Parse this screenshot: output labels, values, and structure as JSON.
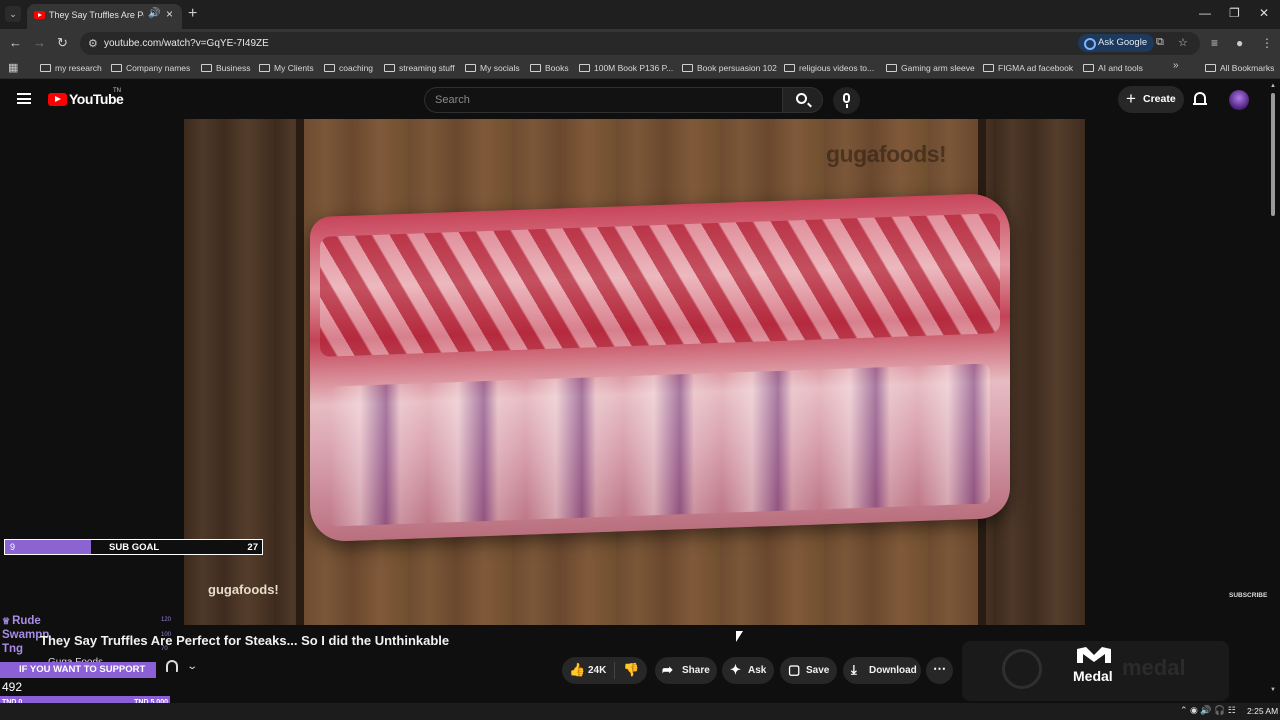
{
  "browser": {
    "tab_title": "They Say Truffles Are Perfect",
    "url": "youtube.com/watch?v=GqYE-7I49ZE",
    "ask_google": "Ask Google",
    "bookmarks": [
      "my research",
      "Company names",
      "Business",
      "My Clients",
      "coaching",
      "streaming stuff",
      "My socials",
      "Books",
      "100M Book P136 P...",
      "Book persuasion 102",
      "religious videos to...",
      "Gaming arm sleeve",
      "FIGMA ad facebook",
      "AI and tools"
    ],
    "all_bookmarks": "All Bookmarks"
  },
  "youtube": {
    "logo_text": "YouTube",
    "logo_sup": "TN",
    "search_placeholder": "Search",
    "create_label": "Create"
  },
  "video": {
    "watermark_top": "gugafoods!",
    "watermark_bottom": "gugafoods!",
    "subscribe_label": "SUBSCRIBE",
    "title": "They Say Truffles Are Perfect for Steaks... So I did the Unthinkable",
    "channel_partial": "Guga Foods",
    "likes": "24K",
    "share_label": "Share",
    "ask_label": "Ask",
    "save_label": "Save",
    "download_label": "Download"
  },
  "overlay": {
    "subgoal_current": "9",
    "subgoal_label": "SUB GOAL",
    "subgoal_target": "27",
    "subgoal_progress": 0.333,
    "chat_name": "Rude Swampp Tng",
    "side_numbers": [
      "120",
      "100",
      "70"
    ],
    "support_label": "IF YOU WANT TO SUPPORT",
    "support_amount": "492",
    "support_min": "TND 0",
    "support_max": "TND 5,000"
  },
  "medal": {
    "name": "Medal",
    "ghost_text": "medal"
  },
  "taskbar": {
    "clock": "2:25 AM"
  }
}
